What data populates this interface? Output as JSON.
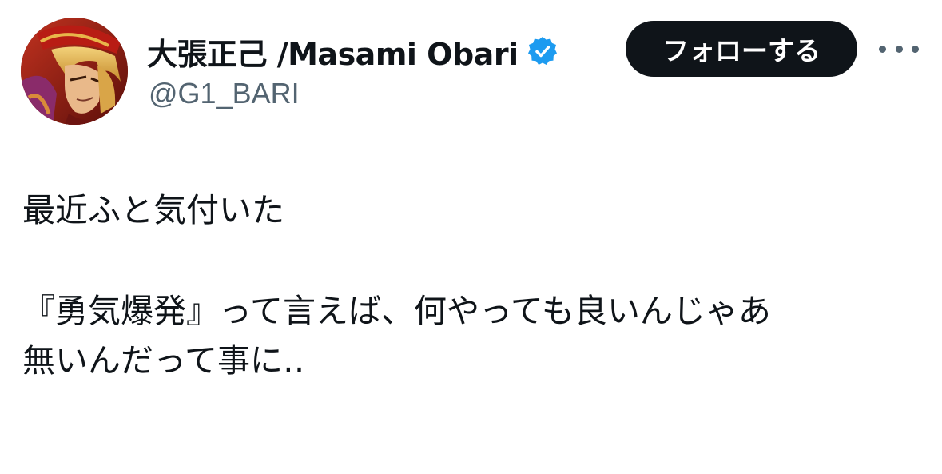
{
  "author": {
    "display_name": "大張正己 /Masami Obari",
    "handle": "@G1_BARI",
    "verified": true
  },
  "actions": {
    "follow_label": "フォローする",
    "more_icon": "more-horizontal-icon"
  },
  "tweet": {
    "lines": [
      "最近ふと気付いた",
      "『勇気爆発』って言えば、何やっても良いんじゃあ",
      "無いんだって事に‥"
    ]
  },
  "colors": {
    "text": "#0f1419",
    "secondary": "#536471",
    "verified": "#1d9bf0",
    "button_bg": "#0f1419",
    "button_text": "#ffffff"
  }
}
